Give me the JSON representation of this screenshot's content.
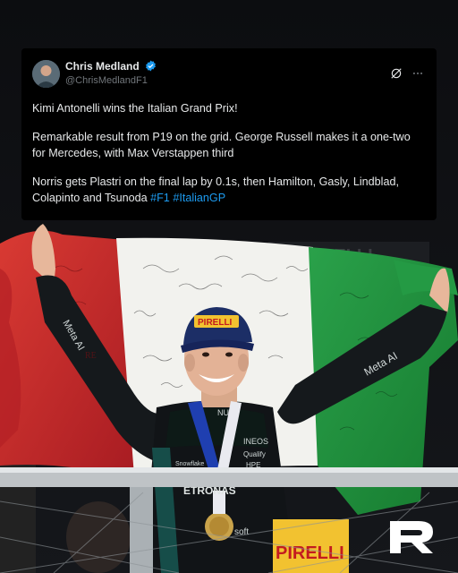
{
  "tweet": {
    "display_name": "Chris Medland",
    "handle": "@ChrisMedlandF1",
    "paragraphs": [
      "Kimi Antonelli wins the Italian Grand Prix!",
      "Remarkable result from P19 on the grid. George Russell makes it a one-two for Mercedes, with Max Verstappen third",
      "Norris gets Plastri on the final lap by 0.1s, then Hamilton, Gasly, Lindblad, Colapinto and Tsunoda"
    ],
    "hashtags": [
      "#F1",
      "#ItalianGP"
    ],
    "icons": [
      "verified-badge-icon",
      "grok-icon",
      "more-options-icon"
    ]
  },
  "photo": {
    "cap_brand": "PIRELLI",
    "shirt_text": "ETRONAS",
    "sleeve_left": "Meta AI",
    "sleeve_right": "Meta AI",
    "chest_small": "INEOS",
    "chest_small_2": "Qualify",
    "chest_small_3": "HPE",
    "chest_left": "Snowflake",
    "collar_text": "NU",
    "bottom_text": "soft",
    "backdrop_text": "PIRELLI",
    "banner_text": "PIRELLI",
    "flag_text": "RE"
  },
  "colors": {
    "flag_green": "#1f8f3a",
    "flag_white": "#f2f2ee",
    "flag_red": "#c8262b",
    "cap_yellow": "#f2c230",
    "hashtag_blue": "#1d9bf0"
  },
  "watermark": {
    "name": "brand-logo-icon"
  }
}
